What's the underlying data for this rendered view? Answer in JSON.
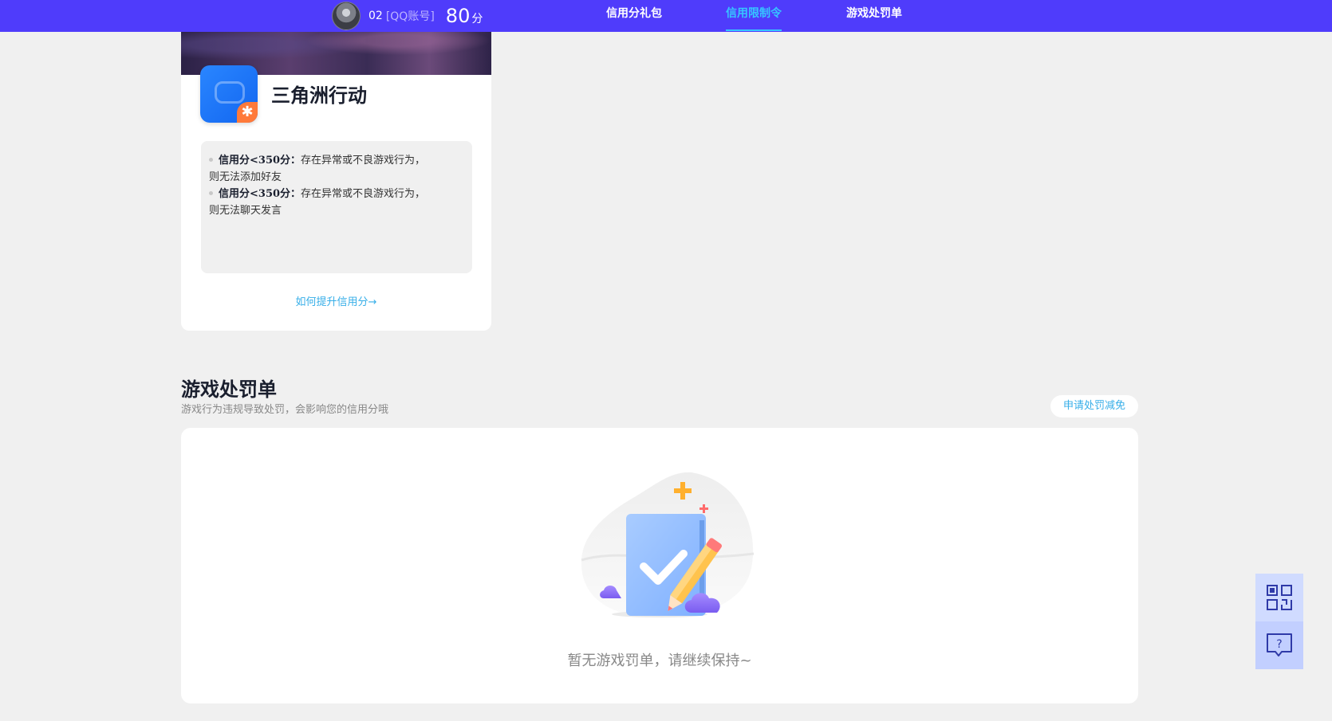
{
  "user": {
    "name": "02",
    "account_type": "[QQ账号]",
    "score": "80",
    "score_unit": "分"
  },
  "nav": {
    "items": [
      {
        "label": "信用分礼包",
        "active": false
      },
      {
        "label": "信用限制令",
        "active": true
      },
      {
        "label": "游戏处罚单",
        "active": false
      }
    ]
  },
  "game_card": {
    "title": "三角洲行动",
    "rules": [
      {
        "strong": "信用分<350分：",
        "text": "存在异常或不良游戏行为，",
        "text2": "则无法添加好友"
      },
      {
        "strong": "信用分<350分：",
        "text": "存在异常或不良游戏行为，",
        "text2": "则无法聊天发言"
      }
    ],
    "improve_link": "如何提升信用分→"
  },
  "penalty": {
    "title": "游戏处罚单",
    "description": "游戏行为违规导致处罚，会影响您的信用分哦",
    "appeal_button": "申请处罚减免",
    "empty_text": "暂无游戏罚单，请继续保持~"
  },
  "colors": {
    "topbar": "#4f3cfb",
    "accent": "#36c6ff",
    "link": "#36aee8"
  },
  "icons": {
    "side_top": "qr-code-icon",
    "side_bottom": "help-chat-icon"
  }
}
